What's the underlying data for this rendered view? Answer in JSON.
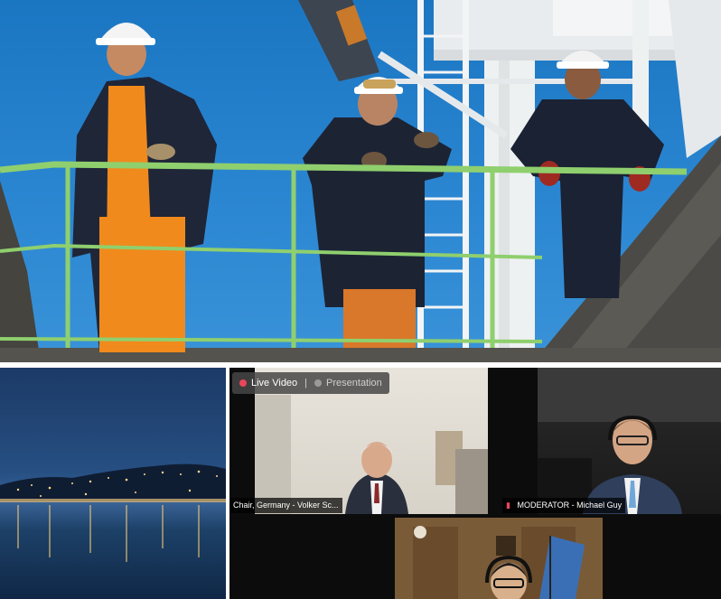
{
  "call": {
    "tabs": [
      {
        "label": "Live Video",
        "active": true,
        "indicator_color": "#e8465a"
      },
      {
        "label": "Presentation",
        "active": false,
        "indicator_color": "#9a9a9a"
      }
    ],
    "separator": "|",
    "participants": [
      {
        "name": "Chair, Germany - Volker Sc..."
      },
      {
        "name": "MODERATOR - Michael Guy",
        "muted_icon": "microphone-muted-icon"
      }
    ]
  },
  "colors": {
    "sky": "#1b76c2",
    "railing": "#8fcf6e",
    "coverall_orange": "#f08a1c",
    "jacket_navy": "#1f2638",
    "ship_white": "#eef1f2",
    "call_background": "#0c0c0c"
  }
}
